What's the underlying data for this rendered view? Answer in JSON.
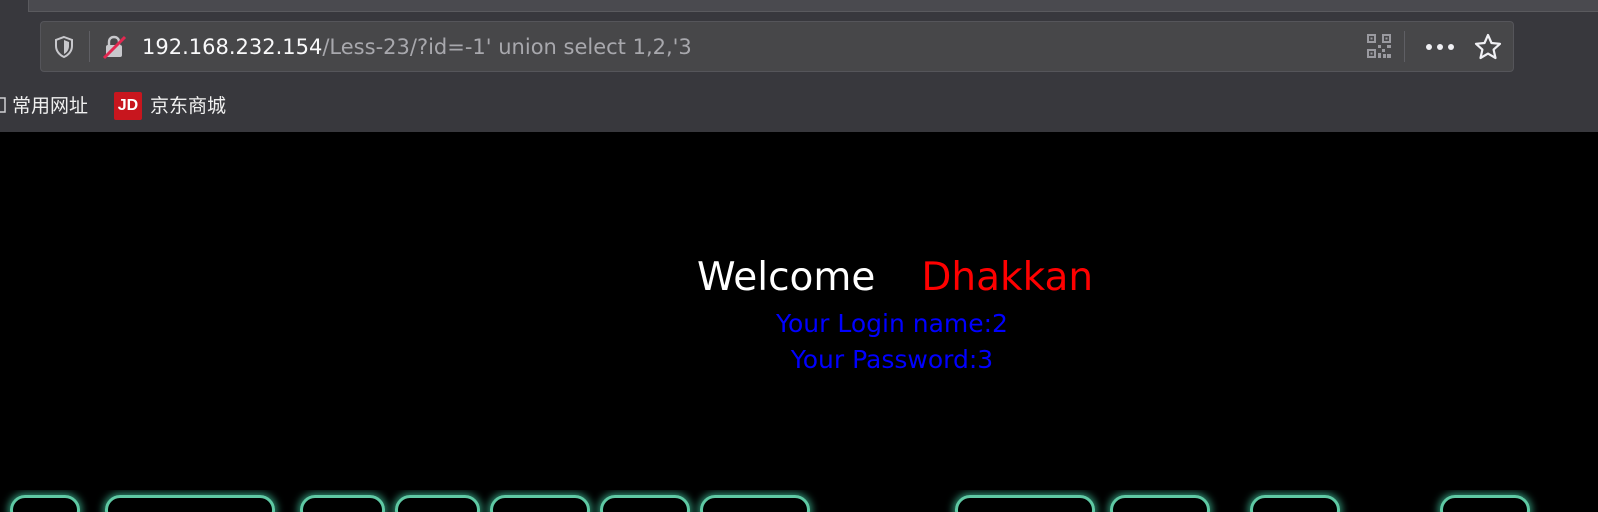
{
  "address_bar": {
    "host": "192.168.232.154",
    "path": "/Less-23/?id=-1' union select 1,2,'3"
  },
  "bookmarks": [
    {
      "label": "常用网址",
      "icon": "folder-icon"
    },
    {
      "label": "京东商城",
      "icon": "jd-icon",
      "icon_text": "JD",
      "icon_color": "#c8161e"
    }
  ],
  "toolbar_icons": [
    "shield-icon",
    "lock-insecure-icon",
    "qr-code-icon",
    "more-icon",
    "star-icon"
  ],
  "page": {
    "welcome_text": "Welcome",
    "welcome_name": "Dhakkan",
    "login_name": "Your Login name:2",
    "password": "Your Password:3"
  },
  "colors": {
    "background": "#000000",
    "welcome": "#ffffff",
    "name": "#ff0000",
    "info": "#0000ff",
    "glow": "#5fc9a4"
  }
}
